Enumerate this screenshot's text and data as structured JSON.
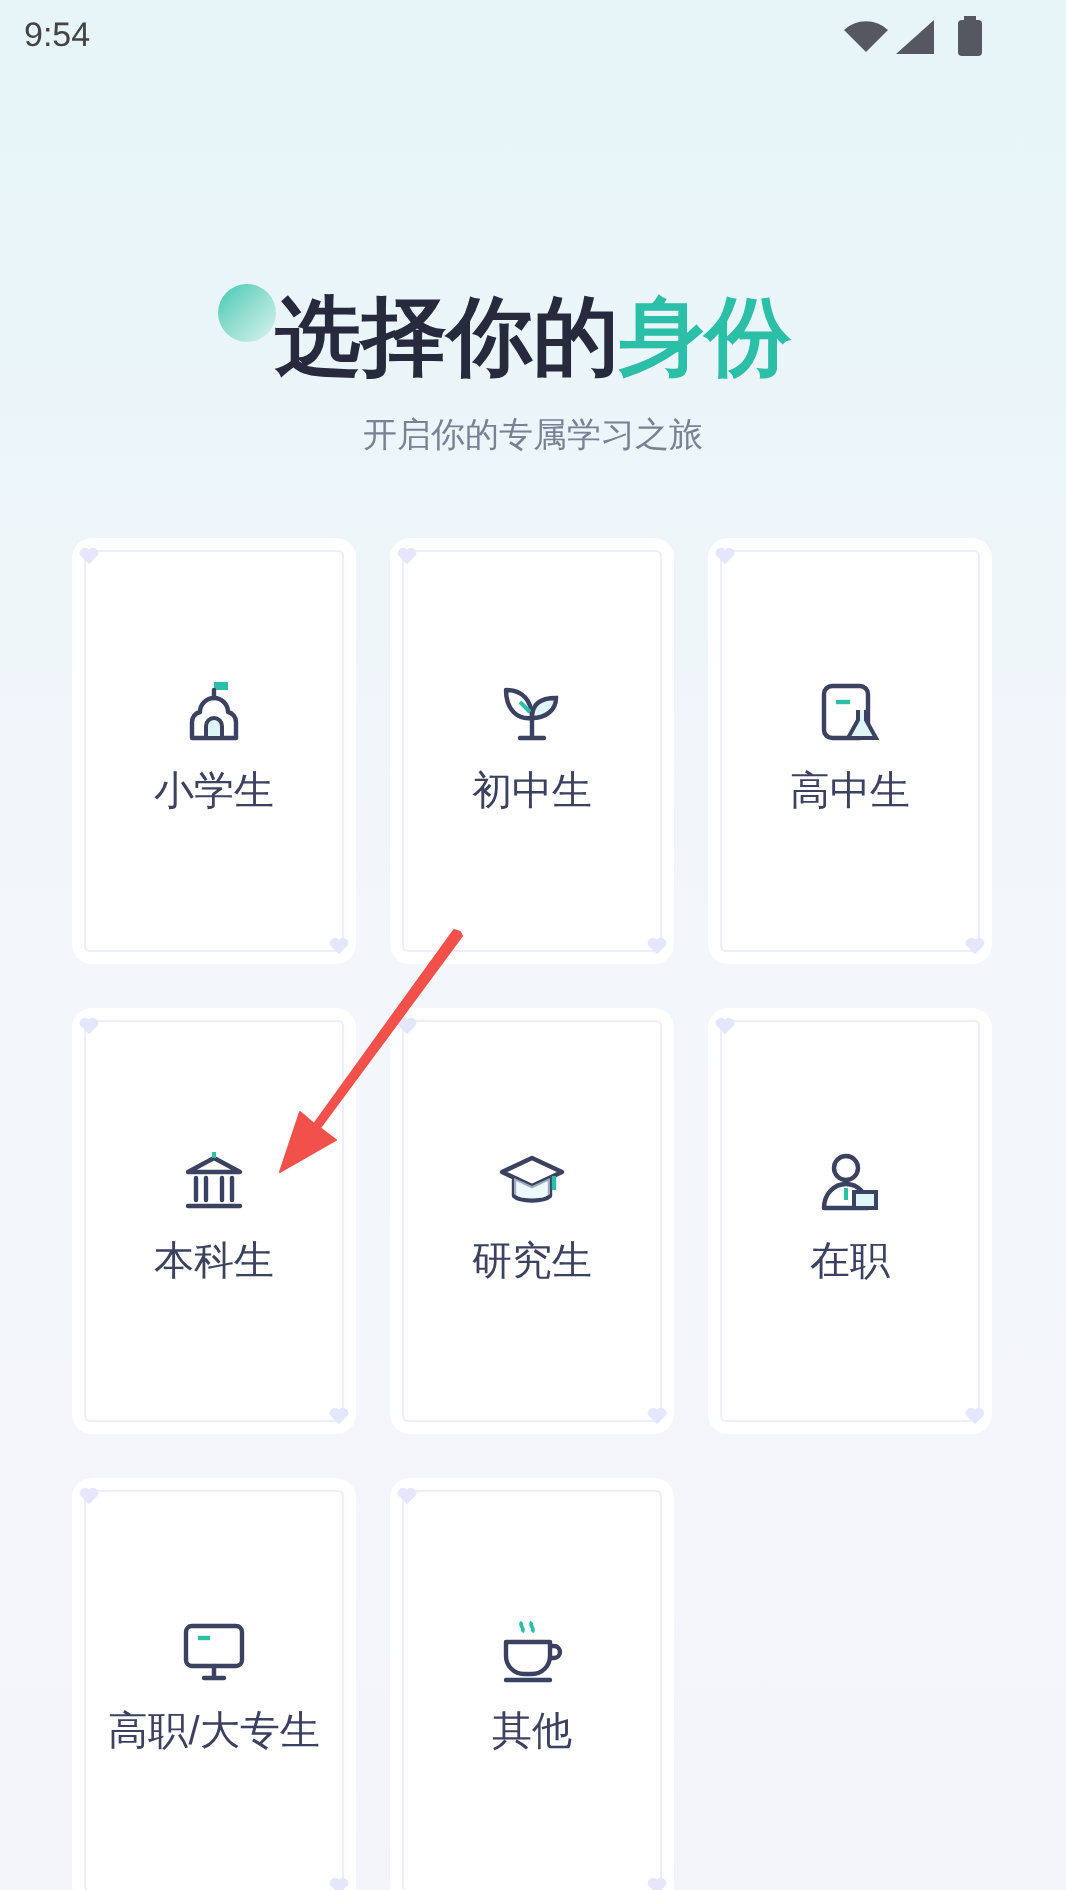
{
  "status_bar": {
    "time": "9:54"
  },
  "header": {
    "title_main": "选择你的",
    "title_highlight": "身份",
    "subtitle": "开启你的专属学习之旅"
  },
  "identities": [
    {
      "label": "小学生"
    },
    {
      "label": "初中生"
    },
    {
      "label": "高中生"
    },
    {
      "label": "本科生"
    },
    {
      "label": "研究生"
    },
    {
      "label": "在职"
    },
    {
      "label": "高职/大专生"
    },
    {
      "label": "其他"
    }
  ]
}
